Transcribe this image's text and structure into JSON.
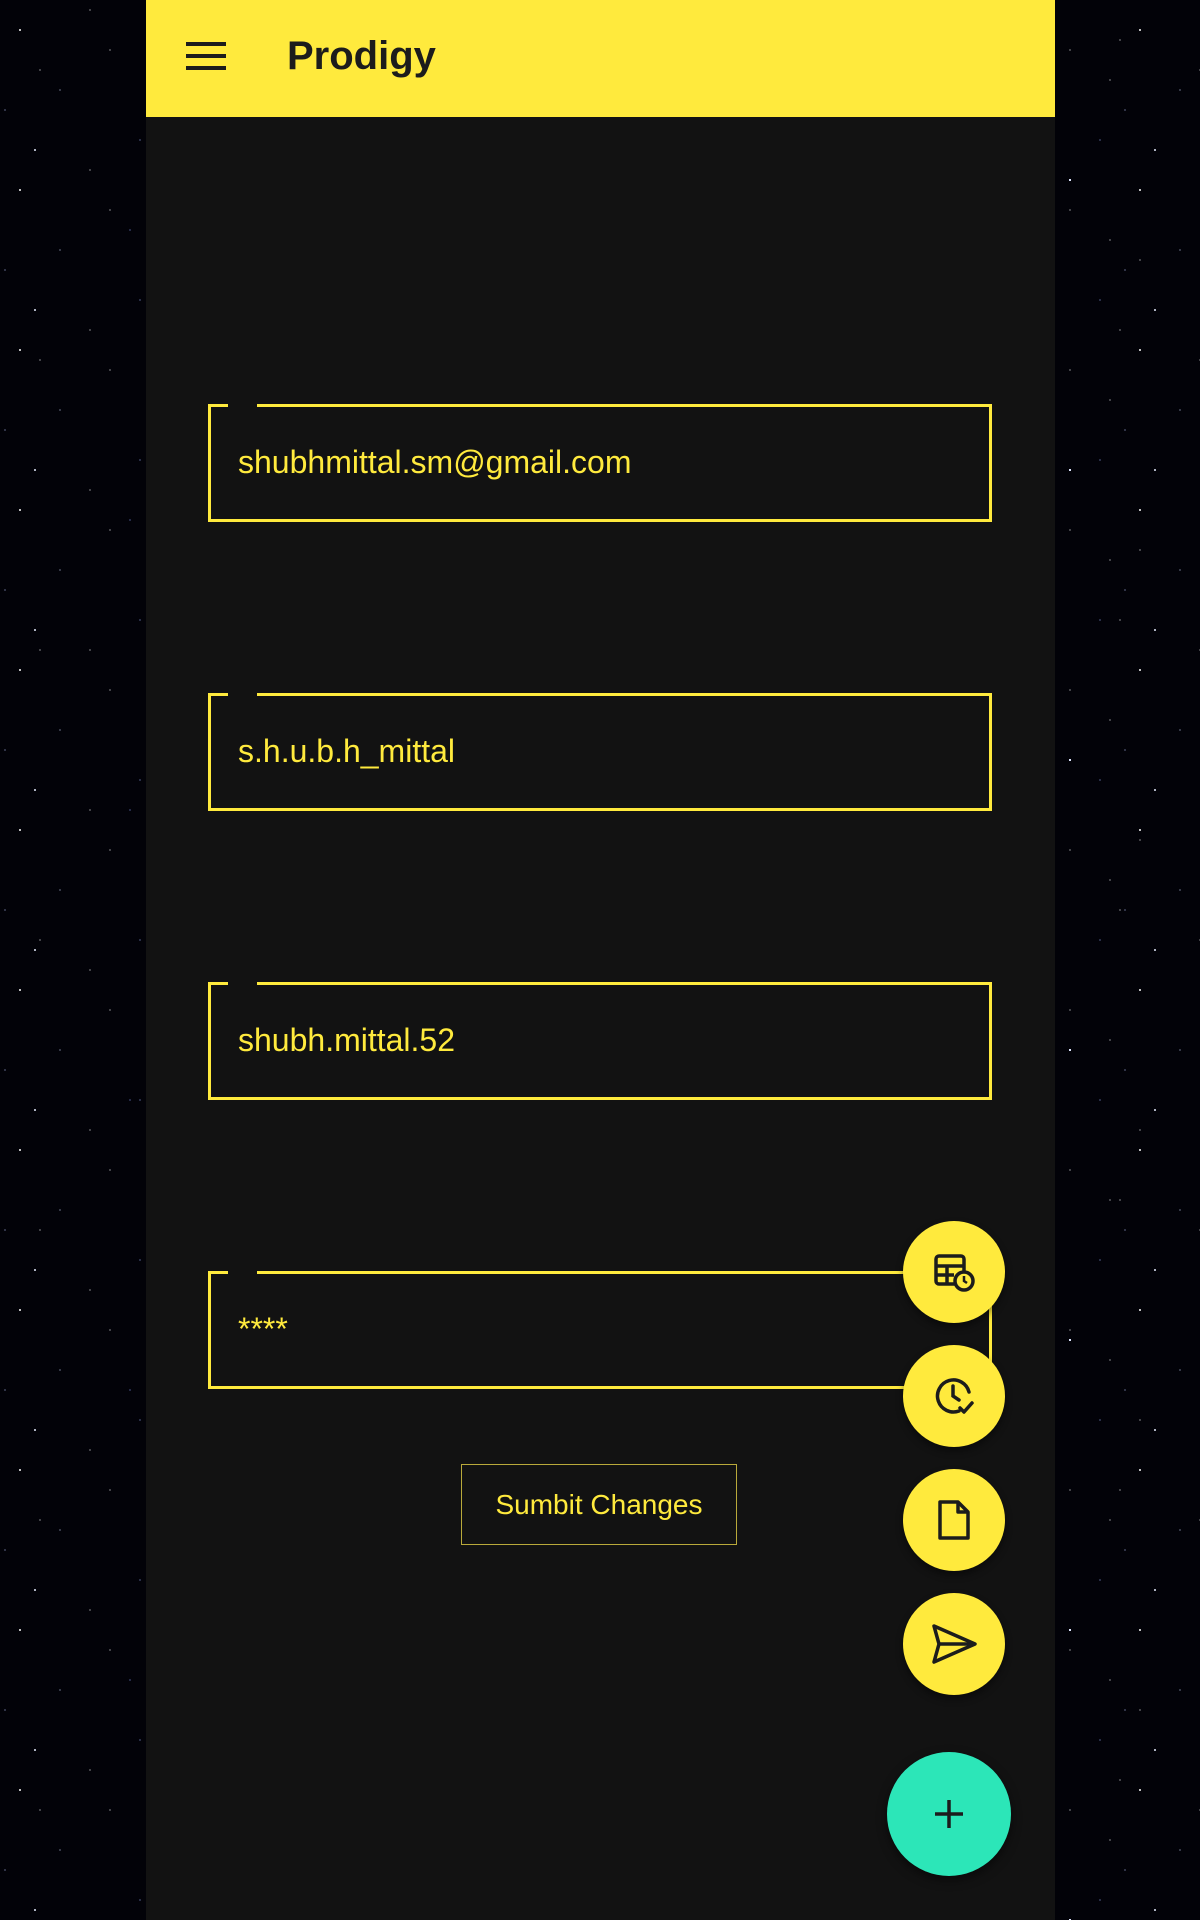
{
  "app": {
    "title": "Prodigy"
  },
  "form": {
    "fields": [
      {
        "name": "email",
        "value": "shubhmittal.sm@gmail.com"
      },
      {
        "name": "username",
        "value": "s.h.u.b.h_mittal"
      },
      {
        "name": "handle",
        "value": "shubh.mittal.52"
      },
      {
        "name": "password",
        "value": "****"
      }
    ],
    "submit_label": "Sumbit Changes"
  },
  "fab_menu": {
    "items": [
      {
        "icon": "schedule-table-icon"
      },
      {
        "icon": "clock-check-icon"
      },
      {
        "icon": "document-icon"
      },
      {
        "icon": "send-icon"
      }
    ],
    "main_icon": "plus-icon"
  },
  "colors": {
    "accent": "#ffea3d",
    "background": "#121212",
    "fab_main": "#2ce6b8"
  }
}
